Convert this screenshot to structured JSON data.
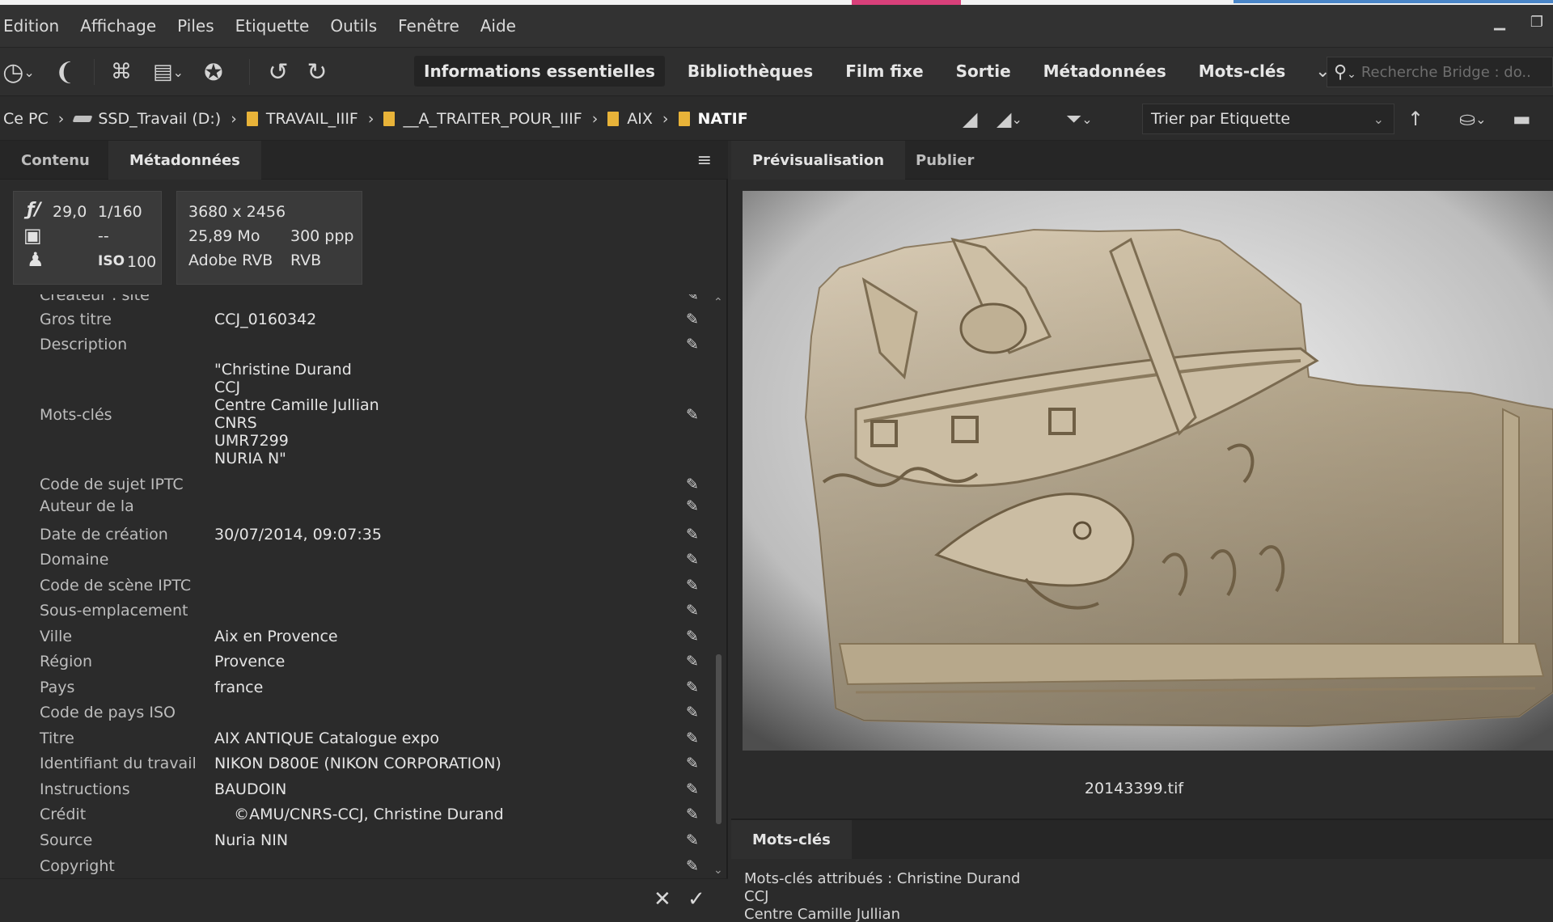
{
  "menubar": {
    "items": [
      "Edition",
      "Affichage",
      "Piles",
      "Etiquette",
      "Outils",
      "Fenêtre",
      "Aide"
    ]
  },
  "toolbar": {
    "workspaces": [
      "Informations essentielles",
      "Bibliothèques",
      "Film fixe",
      "Sortie",
      "Métadonnées",
      "Mots-clés"
    ],
    "active_workspace": "Informations essentielles",
    "search_placeholder": "Recherche Bridge : do..."
  },
  "pathbar": {
    "crumbs": [
      "Ce PC",
      "SSD_Travail (D:)",
      "TRAVAIL_IIIF",
      "__A_TRAITER_POUR_IIIF",
      "AIX",
      "NATIF"
    ],
    "sort_label": "Trier par Etiquette"
  },
  "left_panel": {
    "tabs": [
      "Contenu",
      "Métadonnées"
    ],
    "active_tab": "Métadonnées",
    "camera": {
      "aperture": "29,0",
      "shutter": "1/160",
      "metering": "--",
      "iso_label": "ISO",
      "iso_value": "100"
    },
    "file": {
      "dimensions": "3680 x 2456",
      "size": "25,89 Mo",
      "resolution": "300 ppp",
      "color_profile": "Adobe RVB",
      "color_mode": "RVB"
    },
    "fields": [
      {
        "label": "Créateur : site",
        "value": ""
      },
      {
        "label": "Gros titre",
        "value": "CCJ_0160342"
      },
      {
        "label": "Description",
        "value": ""
      },
      {
        "label": "Mots-clés",
        "value": "\"Christine Durand\nCCJ\nCentre Camille Jullian\nCNRS\nUMR7299\nNURIA N\""
      },
      {
        "label": "Code de sujet IPTC",
        "value": ""
      },
      {
        "label": "Auteur de la",
        "value": ""
      },
      {
        "label": "Date de création",
        "value": "30/07/2014, 09:07:35"
      },
      {
        "label": "Domaine",
        "value": ""
      },
      {
        "label": "Code de scène IPTC",
        "value": ""
      },
      {
        "label": "Sous-emplacement",
        "value": ""
      },
      {
        "label": "Ville",
        "value": "Aix en Provence"
      },
      {
        "label": "Région",
        "value": "Provence"
      },
      {
        "label": "Pays",
        "value": "france"
      },
      {
        "label": "Code de pays ISO",
        "value": ""
      },
      {
        "label": "Titre",
        "value": "AIX ANTIQUE Catalogue expo"
      },
      {
        "label": "Identifiant du travail",
        "value": "NIKON D800E (NIKON CORPORATION)"
      },
      {
        "label": "Instructions",
        "value": "BAUDOIN"
      },
      {
        "label": "Crédit",
        "value": "    ©AMU/CNRS-CCJ, Christine Durand"
      },
      {
        "label": "Source",
        "value": "Nuria NIN"
      },
      {
        "label": "Copyright",
        "value": ""
      }
    ]
  },
  "right_panel": {
    "tabs": [
      "Prévisualisation",
      "Publier"
    ],
    "active_tab": "Prévisualisation",
    "filename": "20143399.tif",
    "keywords_panel": {
      "tab": "Mots-clés",
      "lines": [
        "Mots-clés attribués : Christine Durand",
        "CCJ",
        "Centre Camille Jullian"
      ]
    }
  },
  "colors": {
    "folder": "#e8b339",
    "panel_bg": "#2b2b2b",
    "accent_pink": "#d8407a"
  }
}
